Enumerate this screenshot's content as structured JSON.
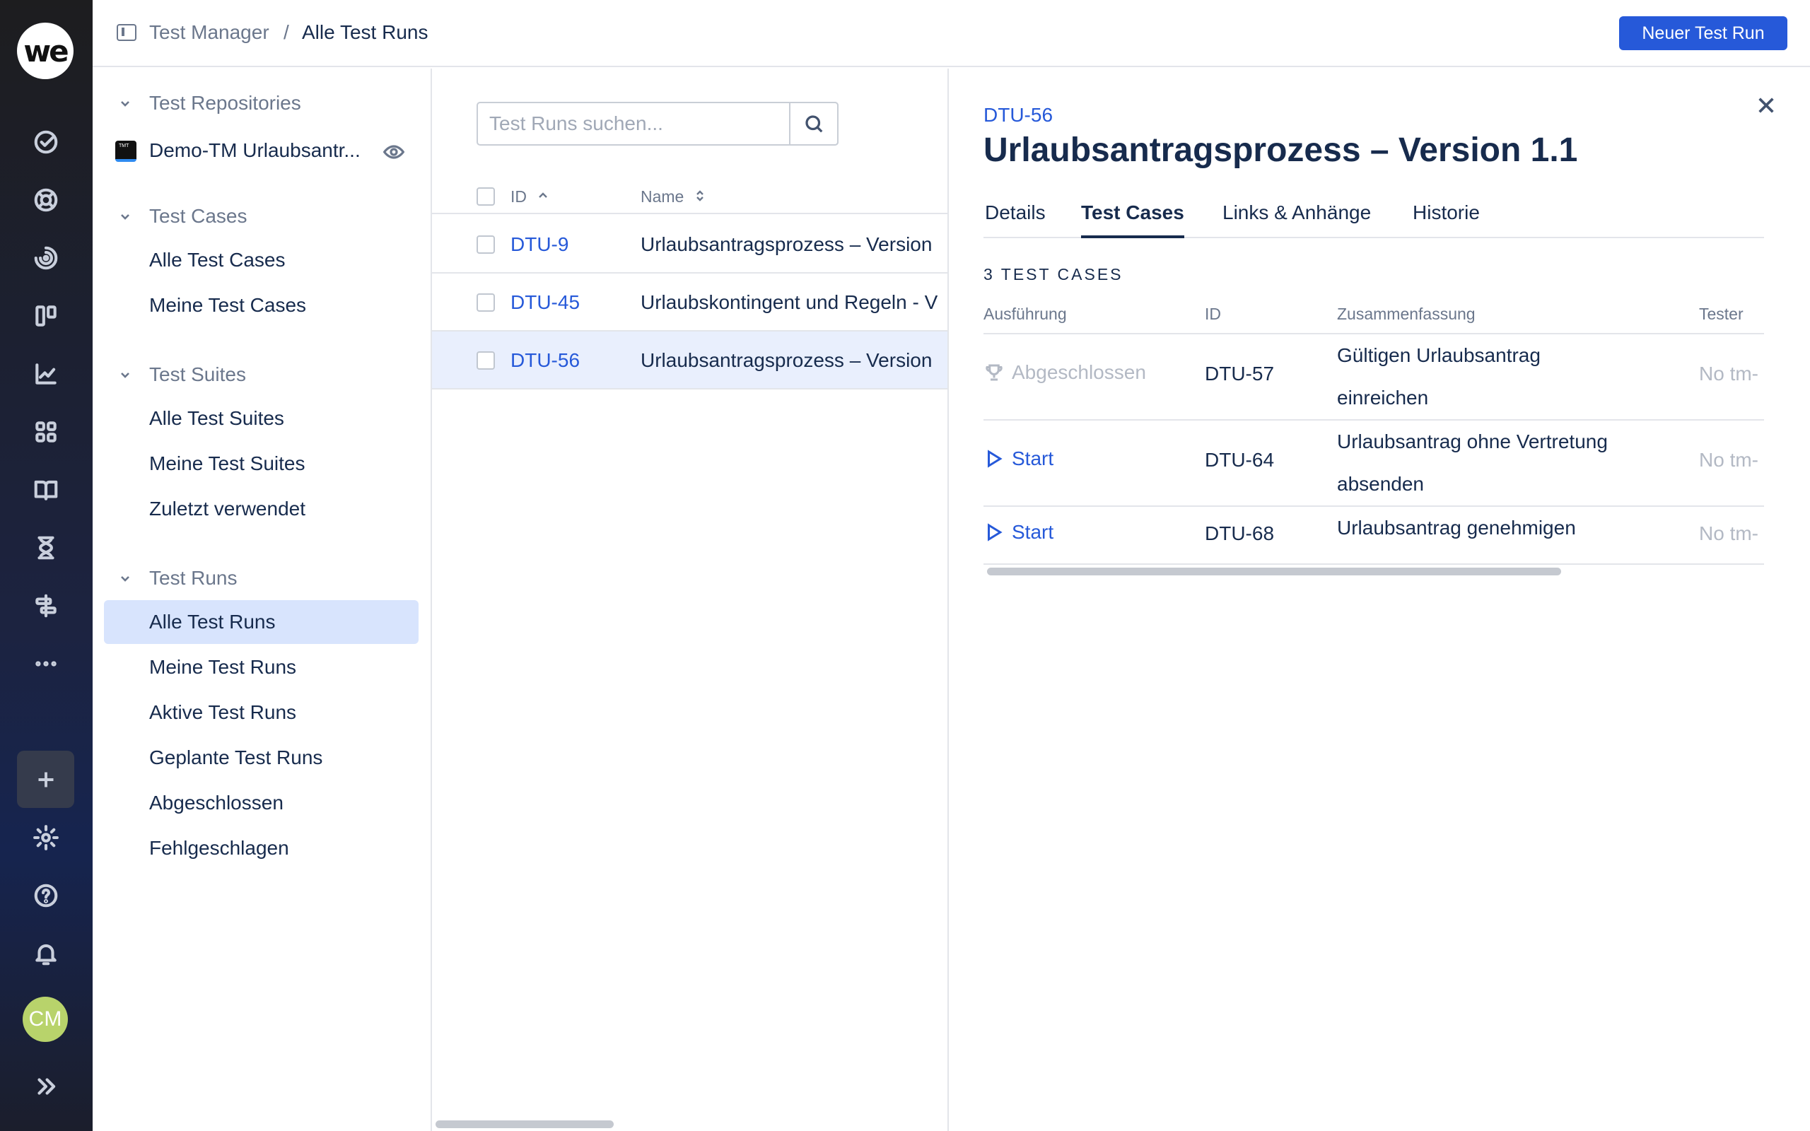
{
  "rail": {
    "logo": "we",
    "avatar_initials": "CM",
    "icons": [
      "check-circle-icon",
      "lifebuoy-icon",
      "spiral-icon",
      "board-icon",
      "chart-icon",
      "apps-icon",
      "book-icon",
      "hourglass-icon",
      "roadmap-icon",
      "more-icon",
      "plus-icon",
      "gear-icon",
      "help-icon",
      "bell-icon",
      "expand-icon"
    ]
  },
  "header": {
    "breadcrumb_root": "Test Manager",
    "breadcrumb_sep": "/",
    "breadcrumb_current": "Alle Test Runs",
    "new_button": "Neuer Test Run"
  },
  "sidebar": {
    "repos_section": "Test Repositories",
    "repo_name": "Demo-TM Urlaubsantr...",
    "repo_icon_text": "TMT",
    "cases_section": "Test Cases",
    "cases_items": [
      "Alle Test Cases",
      "Meine Test Cases"
    ],
    "suites_section": "Test Suites",
    "suites_items": [
      "Alle Test Suites",
      "Meine Test Suites",
      "Zuletzt verwendet"
    ],
    "runs_section": "Test Runs",
    "runs_items": [
      "Alle Test Runs",
      "Meine Test Runs",
      "Aktive Test Runs",
      "Geplante Test Runs",
      "Abgeschlossen",
      "Fehlgeschlagen"
    ],
    "active_item": "Alle Test Runs"
  },
  "list": {
    "search_placeholder": "Test Runs suchen...",
    "col_id": "ID",
    "col_name": "Name",
    "rows": [
      {
        "id": "DTU-9",
        "name": "Urlaubsantragsprozess – Version"
      },
      {
        "id": "DTU-45",
        "name": "Urlaubskontingent und Regeln - V"
      },
      {
        "id": "DTU-56",
        "name": "Urlaubsantragsprozess – Version"
      }
    ],
    "selected_row": "DTU-56"
  },
  "detail": {
    "key": "DTU-56",
    "title": "Urlaubsantragsprozess – Version 1.1",
    "tabs": [
      "Details",
      "Test Cases",
      "Links & Anhänge",
      "Historie"
    ],
    "active_tab": "Test Cases",
    "count_label": "3 TEST CASES",
    "columns": {
      "exec": "Ausführung",
      "id": "ID",
      "summary": "Zusammenfassung",
      "tester": "Tester"
    },
    "cases": [
      {
        "exec": "Abgeschlossen",
        "status": "done",
        "id": "DTU-57",
        "summary": "Gültigen Urlaubsantrag einreichen",
        "tester": "No tm-"
      },
      {
        "exec": "Start",
        "status": "start",
        "id": "DTU-64",
        "summary": "Urlaubsantrag ohne Vertretung absenden",
        "tester": "No tm-"
      },
      {
        "exec": "Start",
        "status": "start",
        "id": "DTU-68",
        "summary": "Urlaubsantrag genehmigen",
        "tester": "No tm-"
      }
    ]
  },
  "colors": {
    "accent": "#2659d9",
    "selected_bg": "#d8e4fd",
    "rail_bg": "#1c2340"
  }
}
